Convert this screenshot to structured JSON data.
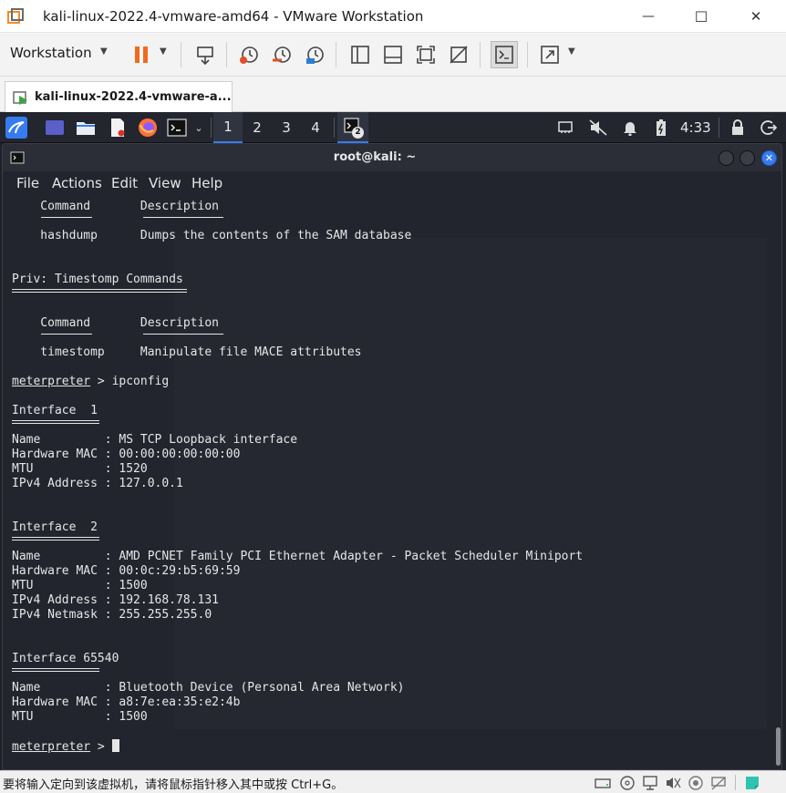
{
  "window": {
    "title": "kali-linux-2022.4-vmware-amd64 - VMware Workstation",
    "minimize_glyph": "—",
    "maximize_glyph": "☐",
    "close_glyph": "✕"
  },
  "toolbar": {
    "workstation_label": "Workstation",
    "icons": [
      "pause-icon",
      "send-ctrl-alt-del-icon",
      "snapshot-icon",
      "revert-snapshot-icon",
      "snapshot-manager-icon",
      "library-icon",
      "thumbnail-icon",
      "fullscreen-icon",
      "unity-icon",
      "console-view-icon",
      "stretch-icon"
    ]
  },
  "tabs": [
    {
      "label": "kali-linux-2022.4-vmware-a..."
    }
  ],
  "kali_panel": {
    "workspaces": [
      "1",
      "2",
      "3",
      "4"
    ],
    "active_workspace": "1",
    "terminal_badge": "2",
    "clock": "4:33"
  },
  "terminal": {
    "title": "root@kali: ~",
    "menu": [
      "File",
      "Actions",
      "Edit",
      "View",
      "Help"
    ],
    "lines": [
      {
        "text": "    Command       Description"
      },
      {
        "text": "    hashdump      Dumps the contents of the SAM database"
      },
      {
        "text": "Priv: Timestomp Commands"
      },
      {
        "text": "    Command       Description"
      },
      {
        "text": "    timestomp     Manipulate file MACE attributes"
      },
      {
        "text": "Interface  1"
      },
      {
        "text": "Name         : MS TCP Loopback interface"
      },
      {
        "text": "Hardware MAC : 00:00:00:00:00:00"
      },
      {
        "text": "MTU          : 1520"
      },
      {
        "text": "IPv4 Address : 127.0.0.1"
      },
      {
        "text": "Interface  2"
      },
      {
        "text": "Name         : AMD PCNET Family PCI Ethernet Adapter - Packet Scheduler Miniport"
      },
      {
        "text": "Hardware MAC : 00:0c:29:b5:69:59"
      },
      {
        "text": "MTU          : 1500"
      },
      {
        "text": "IPv4 Address : 192.168.78.131"
      },
      {
        "text": "IPv4 Netmask : 255.255.255.0"
      },
      {
        "text": "Interface 65540"
      },
      {
        "text": "Name         : Bluetooth Device (Personal Area Network)"
      },
      {
        "text": "Hardware MAC : a8:7e:ea:35:e2:4b"
      },
      {
        "text": "MTU          : 1500"
      }
    ],
    "prompt_word": "meterpreter",
    "prompt_suffix": " > ",
    "command_ipconfig": "ipconfig"
  },
  "statusbar": {
    "text": "要将输入定向到该虚拟机，请将鼠标指针移入其中或按 Ctrl+G。"
  },
  "colors": {
    "accent": "#367bf0",
    "terminal_bg": "#23252e",
    "terminal_fg": "#e6e6e6",
    "pause_orange": "#f06a1e"
  }
}
